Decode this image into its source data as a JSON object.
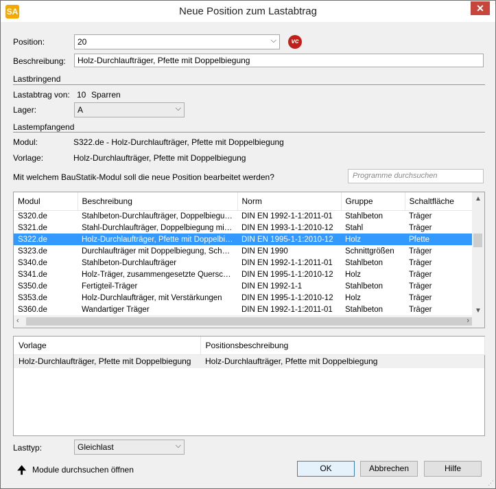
{
  "window": {
    "title": "Neue Position zum Lastabtrag",
    "icon": "app-icon",
    "icon_text": "SA",
    "close_label": "✕"
  },
  "form": {
    "position_label": "Position:",
    "position_value": "20",
    "vc_icon_text": "vc",
    "beschreibung_label": "Beschreibung:",
    "beschreibung_value": "Holz-Durchlaufträger, Pfette mit Doppelbiegung"
  },
  "lastbringend": {
    "title": "Lastbringend",
    "lastabtrag_label": "Lastabtrag von:",
    "lastabtrag_count": "10",
    "lastabtrag_unit": "Sparren",
    "lager_label": "Lager:",
    "lager_value": "A"
  },
  "lastempfangend": {
    "title": "Lastempfangend",
    "modul_label": "Modul:",
    "modul_value": "S322.de - Holz-Durchlaufträger, Pfette mit Doppelbiegung",
    "vorlage_label": "Vorlage:",
    "vorlage_value": "Holz-Durchlaufträger, Pfette mit Doppelbiegung"
  },
  "question": "Mit welchem BauStatik-Modul soll die neue Position bearbeitet werden?",
  "search": {
    "placeholder": "Programme durchsuchen"
  },
  "modules_table": {
    "headers": [
      "Modul",
      "Beschreibung",
      "Norm",
      "Gruppe",
      "Schaltfläche"
    ],
    "rows": [
      [
        "S320.de",
        "Stahlbeton-Durchlaufträger, Doppelbiegun...",
        "DIN EN 1992-1-1:2011-01",
        "Stahlbeton",
        "Träger"
      ],
      [
        "S321.de",
        "Stahl-Durchlaufträger, Doppelbiegung mit T...",
        "DIN EN 1993-1-1:2010-12",
        "Stahl",
        "Träger"
      ],
      [
        "S322.de",
        "Holz-Durchlaufträger, Pfette mit Doppelbie...",
        "DIN EN 1995-1-1:2010-12",
        "Holz",
        "Pfette"
      ],
      [
        "S323.de",
        "Durchlaufträger mit Doppelbiegung, Schnitt...",
        "DIN EN 1990",
        "Schnittgrößen",
        "Träger"
      ],
      [
        "S340.de",
        "Stahlbeton-Durchlaufträger",
        "DIN EN 1992-1-1:2011-01",
        "Stahlbeton",
        "Träger"
      ],
      [
        "S341.de",
        "Holz-Träger, zusammengesetzte Querschnitte",
        "DIN EN 1995-1-1:2010-12",
        "Holz",
        "Träger"
      ],
      [
        "S350.de",
        "Fertigteil-Träger",
        "DIN EN 1992-1-1",
        "Stahlbeton",
        "Träger"
      ],
      [
        "S353.de",
        "Holz-Durchlaufträger, mit Verstärkungen",
        "DIN EN 1995-1-1:2010-12",
        "Holz",
        "Träger"
      ],
      [
        "S360.de",
        "Wandartiger Träger",
        "DIN EN 1992-1-1:2011-01",
        "Stahlbeton",
        "Träger"
      ]
    ],
    "selected_index": 2
  },
  "vorlagen_table": {
    "headers": [
      "Vorlage",
      "Positionsbeschreibung"
    ],
    "rows": [
      [
        "Holz-Durchlaufträger, Pfette mit Doppelbiegung",
        "Holz-Durchlaufträger, Pfette mit Doppelbiegung"
      ]
    ]
  },
  "lasttyp": {
    "label": "Lasttyp:",
    "value": "Gleichlast"
  },
  "footer": {
    "module_search_label": "Module durchsuchen öffnen",
    "ok_label": "OK",
    "cancel_label": "Abbrechen",
    "help_label": "Hilfe"
  },
  "colors": {
    "selection": "#3399ff",
    "close_button": "#c7463b",
    "vc_badge": "#c0201b"
  }
}
